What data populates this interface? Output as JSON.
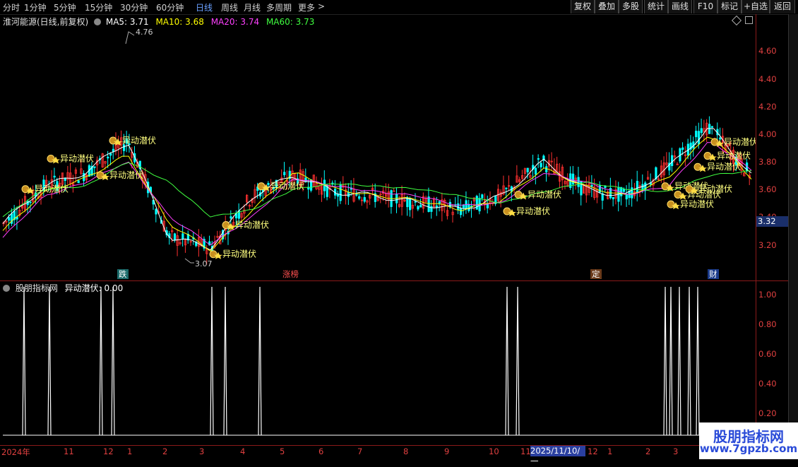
{
  "toolbar": {
    "periods": [
      "分时",
      "1分钟",
      "5分钟",
      "15分钟",
      "30分钟",
      "60分钟",
      "日线",
      "周线",
      "月线",
      "多周期",
      "更多"
    ],
    "active_period": "日线",
    "more_arrow": ">",
    "buttons": [
      "复权",
      "叠加",
      "多股",
      "统计",
      "画线",
      "F10",
      "标记",
      "+自选",
      "返回"
    ]
  },
  "main": {
    "title": "淮河能源(日线,前复权)",
    "ma": [
      {
        "label": "MA5: 3.71",
        "color": "#ffffff"
      },
      {
        "label": "MA10: 3.68",
        "color": "#ffff00"
      },
      {
        "label": "MA20: 3.74",
        "color": "#ff40ff"
      },
      {
        "label": "MA60: 3.73",
        "color": "#40ff40"
      }
    ],
    "high_label": "4.76",
    "low_label": "3.07",
    "current_price": "3.32",
    "axis_ticks": [
      "4.60",
      "4.40",
      "4.20",
      "4.00",
      "3.80",
      "3.60",
      "3.40",
      "3.20"
    ],
    "signal_label": "异动潜伏",
    "events": [
      "跌",
      "涨榜",
      "定",
      "财"
    ],
    "icons": [
      "diamond-icon",
      "restore-icon"
    ]
  },
  "sub": {
    "title": "股朋指标网",
    "indicator": "异动潜伏: 0.00",
    "axis_ticks": [
      "1.00",
      "0.80",
      "0.60",
      "0.40",
      "0.20"
    ]
  },
  "dates": [
    "2024年",
    "11",
    "12",
    "1",
    "2",
    "3",
    "4",
    "5",
    "6",
    "7",
    "8",
    "9",
    "10",
    "11",
    "2025/11/10/一",
    "12",
    "1",
    "2",
    "3"
  ],
  "watermark": {
    "title": "股朋指标网",
    "url": "www.7gpzb.com"
  },
  "colors": {
    "up": "#ff3030",
    "down": "#00ffff",
    "ma5": "#ffffff",
    "ma10": "#ffff00",
    "ma20": "#ff40ff",
    "ma60": "#40ff40",
    "signal": "#ffff80",
    "axis": "#e04040"
  },
  "chart_data": {
    "type": "line",
    "title": "淮河能源(日线,前复权)",
    "price_range": [
      3.07,
      4.76
    ],
    "ylim": [
      3.05,
      4.78
    ],
    "x": [
      "2024-10",
      "2024-11",
      "2024-12",
      "2025-01",
      "2025-02",
      "2025-03",
      "2025-04",
      "2025-05",
      "2025-06",
      "2025-07",
      "2025-08",
      "2025-09",
      "2025-10",
      "2025-11",
      "2025-12",
      "2026-01",
      "2026-02",
      "2026-03"
    ],
    "series": [
      {
        "name": "MA5",
        "values": [
          3.35,
          3.62,
          3.72,
          3.95,
          3.25,
          3.18,
          3.55,
          3.7,
          3.58,
          3.55,
          3.5,
          3.45,
          3.55,
          3.8,
          3.6,
          3.55,
          3.75,
          4.05,
          3.71
        ]
      },
      {
        "name": "MA10",
        "values": [
          3.3,
          3.58,
          3.68,
          3.85,
          3.35,
          3.16,
          3.45,
          3.72,
          3.6,
          3.55,
          3.52,
          3.45,
          3.52,
          3.75,
          3.62,
          3.55,
          3.68,
          4.0,
          3.68
        ]
      },
      {
        "name": "MA20",
        "values": [
          3.25,
          3.55,
          3.65,
          3.8,
          3.4,
          3.2,
          3.4,
          3.68,
          3.62,
          3.58,
          3.55,
          3.48,
          3.5,
          3.72,
          3.65,
          3.56,
          3.62,
          3.95,
          3.74
        ]
      },
      {
        "name": "MA60",
        "values": [
          3.4,
          3.6,
          3.62,
          3.8,
          3.65,
          3.4,
          3.45,
          3.6,
          3.64,
          3.62,
          3.6,
          3.55,
          3.5,
          3.58,
          3.65,
          3.6,
          3.58,
          3.7,
          3.73
        ]
      }
    ],
    "signals": [
      3.6,
      3.82,
      3.7,
      3.95,
      3.13,
      3.34,
      3.62,
      3.44,
      3.56,
      3.62,
      3.49,
      3.56,
      3.6,
      3.76,
      3.84,
      3.94
    ],
    "indicator": {
      "name": "异动潜伏",
      "values": [
        1,
        1,
        1,
        1,
        1,
        1,
        1,
        1,
        1,
        1,
        1,
        1,
        1,
        1,
        1,
        1
      ],
      "current": 0.0
    }
  }
}
